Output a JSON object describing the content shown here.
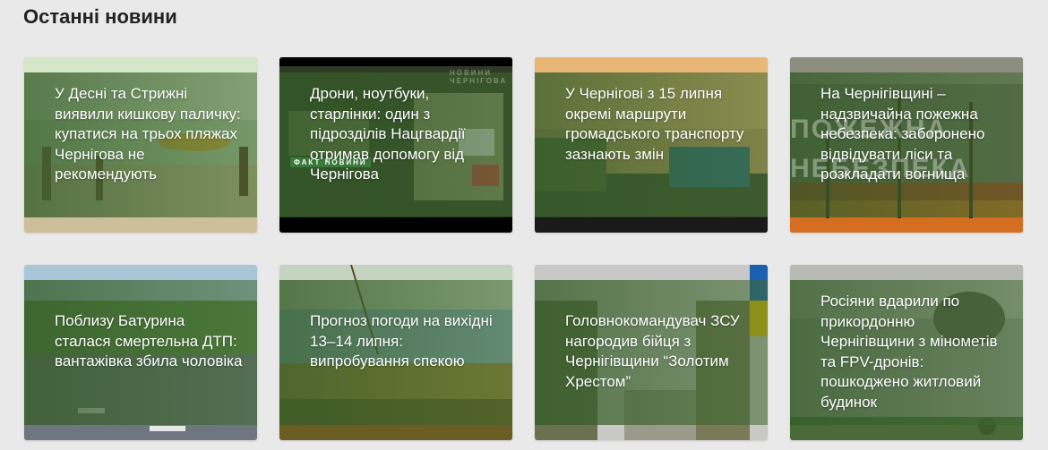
{
  "section": {
    "title": "Останні новини"
  },
  "news": [
    {
      "headline": "У Десні та Стрижні виявили кишкову паличку: купатися на трьох пляжах Чернігова не рекомендують",
      "image_icon": "beach-photo"
    },
    {
      "headline": "Дрони, ноутбуки, старлінки: один з підрозділів Нацгвардії отримав допомогу від Чернігова",
      "image_icon": "donation-photo",
      "image_text": [
        "НОВИНИ ЧЕРНІГОВА",
        "ФАКТ НОВИНИ"
      ]
    },
    {
      "headline": "У Чернігові з 15 липня окремі маршрути громадського транспорту зазнають змін",
      "image_icon": "trolleybus-photo"
    },
    {
      "headline": "На Чернігівщині – надзвичайна пожежна небезпека: заборонено відвідувати ліси та розкладати вогнища",
      "image_icon": "forest-fire-photo",
      "image_text": [
        "ПОЖЕЖНА",
        "НЕБЕЗПЕКА"
      ]
    },
    {
      "headline": "Поблизу Батурина сталася смертельна ДТП: вантажівка збила чоловіка",
      "image_icon": "road-photo"
    },
    {
      "headline": "Прогноз погоди на вихідні 13–14 липня: випробування спекою",
      "image_icon": "field-photo"
    },
    {
      "headline": "Головнокомандувач ЗСУ нагородив бійця з Чернігівщини “Золотим Хрестом”",
      "image_icon": "soldiers-photo"
    },
    {
      "headline": "Росіяни вдарили по прикордонню Чернігівщини з мінометів та FPV-дронів: пошкоджено житловий будинок",
      "image_icon": "explosion-photo"
    }
  ]
}
